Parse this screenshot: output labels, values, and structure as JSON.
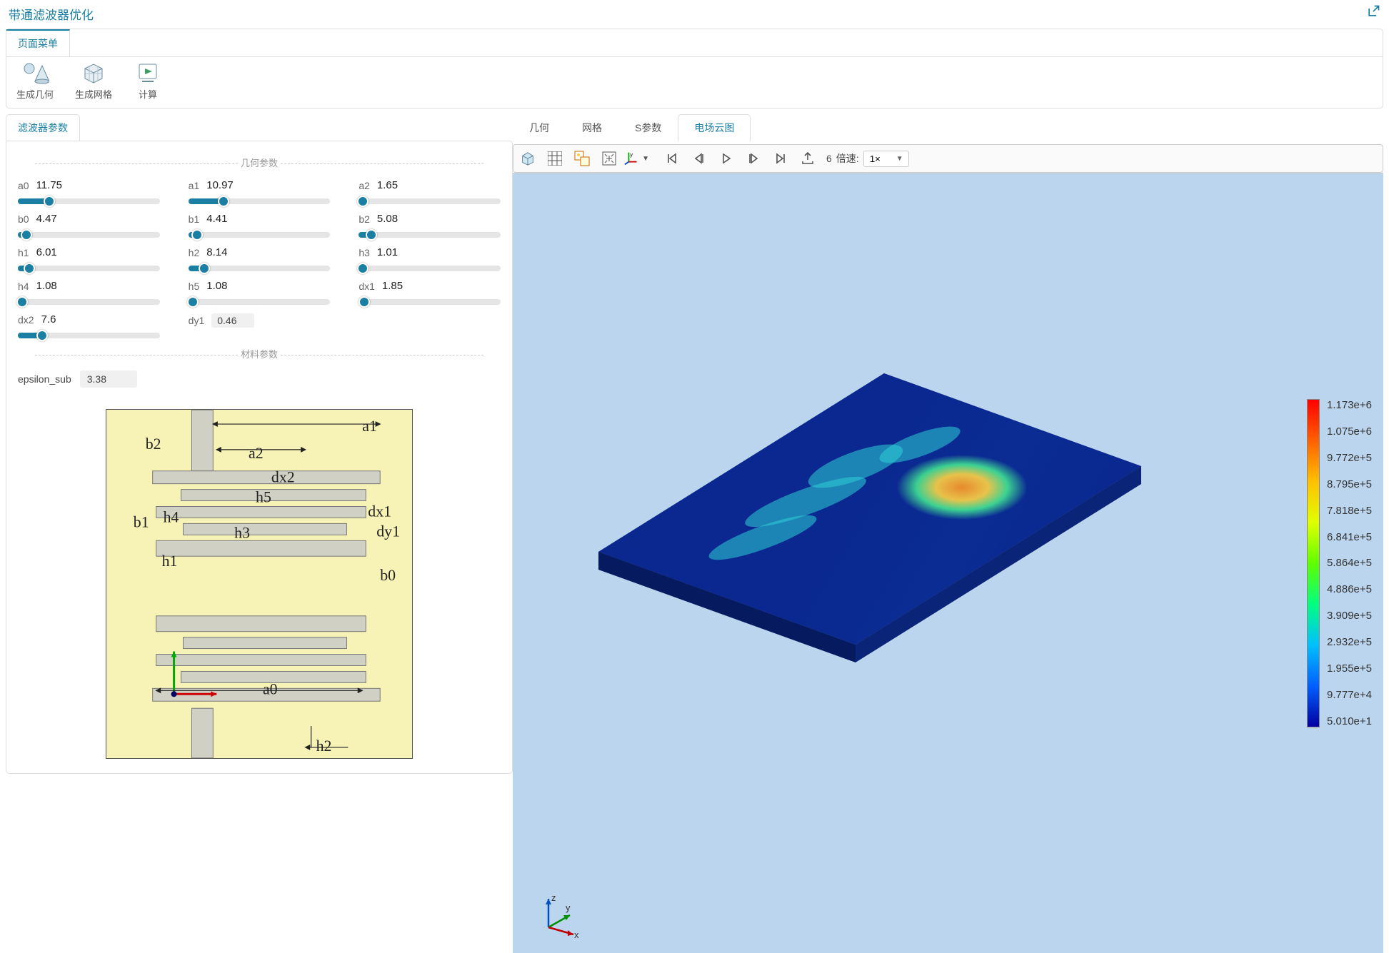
{
  "title": "带通滤波器优化",
  "page_menu_tab": "页面菜单",
  "toolbar": {
    "gen_geom": "生成几何",
    "gen_mesh": "生成网格",
    "compute": "计算"
  },
  "left_panel": {
    "tab": "滤波器参数",
    "geom_section": "几何参数",
    "mat_section": "材料参数",
    "params": [
      {
        "name": "a0",
        "value": "11.75",
        "pct": 22
      },
      {
        "name": "a1",
        "value": "10.97",
        "pct": 25
      },
      {
        "name": "a2",
        "value": "1.65",
        "pct": 3
      },
      {
        "name": "b0",
        "value": "4.47",
        "pct": 6
      },
      {
        "name": "b1",
        "value": "4.41",
        "pct": 6
      },
      {
        "name": "b2",
        "value": "5.08",
        "pct": 9
      },
      {
        "name": "h1",
        "value": "6.01",
        "pct": 8
      },
      {
        "name": "h2",
        "value": "8.14",
        "pct": 11
      },
      {
        "name": "h3",
        "value": "1.01",
        "pct": 3
      },
      {
        "name": "h4",
        "value": "1.08",
        "pct": 3
      },
      {
        "name": "h5",
        "value": "1.08",
        "pct": 3
      },
      {
        "name": "dx1",
        "value": "1.85",
        "pct": 4
      },
      {
        "name": "dx2",
        "value": "7.6",
        "pct": 17
      }
    ],
    "dy1_name": "dy1",
    "dy1_value": "0.46",
    "eps_name": "epsilon_sub",
    "eps_value": "3.38"
  },
  "right_tabs": {
    "geom": "几何",
    "mesh": "网格",
    "spar": "S参数",
    "efield": "电场云图"
  },
  "playback": {
    "frame_prefix": "6",
    "speed_label": "倍速:",
    "speed": "1×"
  },
  "legend_ticks": [
    "1.173e+6",
    "1.075e+6",
    "9.772e+5",
    "8.795e+5",
    "7.818e+5",
    "6.841e+5",
    "5.864e+5",
    "4.886e+5",
    "3.909e+5",
    "2.932e+5",
    "1.955e+5",
    "9.777e+4",
    "5.010e+1"
  ],
  "triad": {
    "x": "x",
    "y": "y",
    "z": "z"
  },
  "schematic_labels": {
    "a0": "a0",
    "a1": "a1",
    "a2": "a2",
    "b0": "b0",
    "b1": "b1",
    "b2": "b2",
    "h1": "h1",
    "h2": "h2",
    "h3": "h3",
    "h4": "h4",
    "h5": "h5",
    "dx1": "dx1",
    "dx2": "dx2",
    "dy1": "dy1"
  }
}
